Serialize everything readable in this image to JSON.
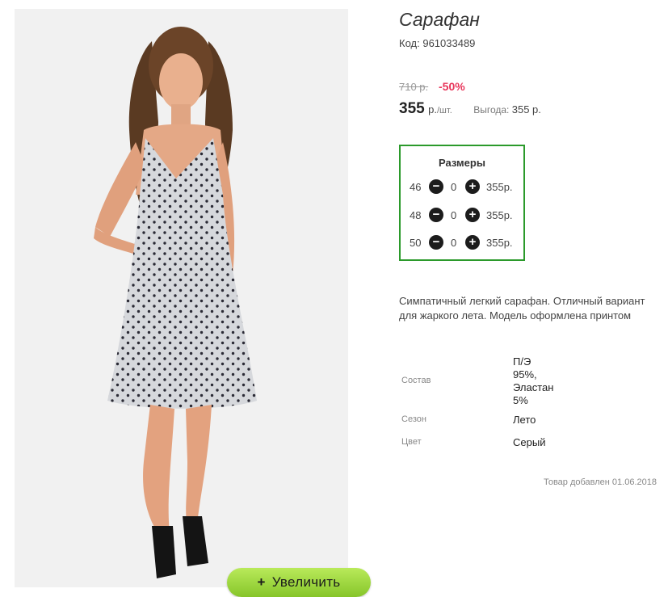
{
  "product": {
    "title": "Сарафан",
    "code_label": "Код:",
    "code": "961033489",
    "old_price": "710 р.",
    "discount": "-50%",
    "price": "355",
    "price_unit": "р.",
    "price_per": "/шт.",
    "benefit_label": "Выгода:",
    "benefit_value": "355 р."
  },
  "sizes": {
    "title": "Размеры",
    "rows": [
      {
        "size": "46",
        "qty": "0",
        "price": "355р."
      },
      {
        "size": "48",
        "qty": "0",
        "price": "355р."
      },
      {
        "size": "50",
        "qty": "0",
        "price": "355р."
      }
    ],
    "minus_icon": "minus-circle-icon",
    "plus_icon": "plus-circle-icon"
  },
  "description": "Симпатичный легкий сарафан. Отличный вариант для жаркого лета. Модель оформлена принтом",
  "specs": [
    {
      "label": "Состав",
      "value_lines": [
        "П/Э",
        "95%,",
        "Эластан",
        "5%"
      ]
    },
    {
      "label": "Сезон",
      "value_lines": [
        "Лето"
      ]
    },
    {
      "label": "Цвет",
      "value_lines": [
        "Серый"
      ]
    }
  ],
  "added_text": "Товар добавлен 01.06.2018",
  "zoom_button": {
    "icon": "+",
    "label": "Увеличить"
  },
  "colors": {
    "accent_green": "#2b9a2b",
    "discount_red": "#e8355a",
    "button_green": "#9ad63c"
  }
}
